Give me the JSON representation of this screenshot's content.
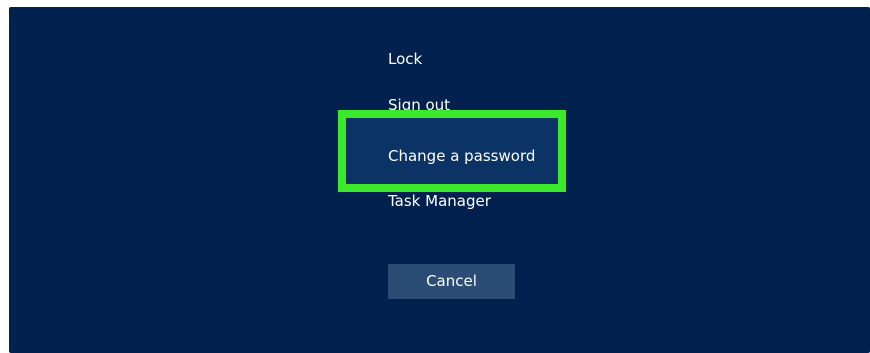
{
  "menu": {
    "lock": "Lock",
    "sign_out": "Sign out",
    "change_password": "Change a password",
    "task_manager": "Task Manager"
  },
  "cancel_label": "Cancel",
  "colors": {
    "background": "#02214f",
    "highlight_border": "#3aea2a",
    "highlight_fill": "#0b3366",
    "button": "#2b4c75",
    "text": "#ffffff"
  }
}
